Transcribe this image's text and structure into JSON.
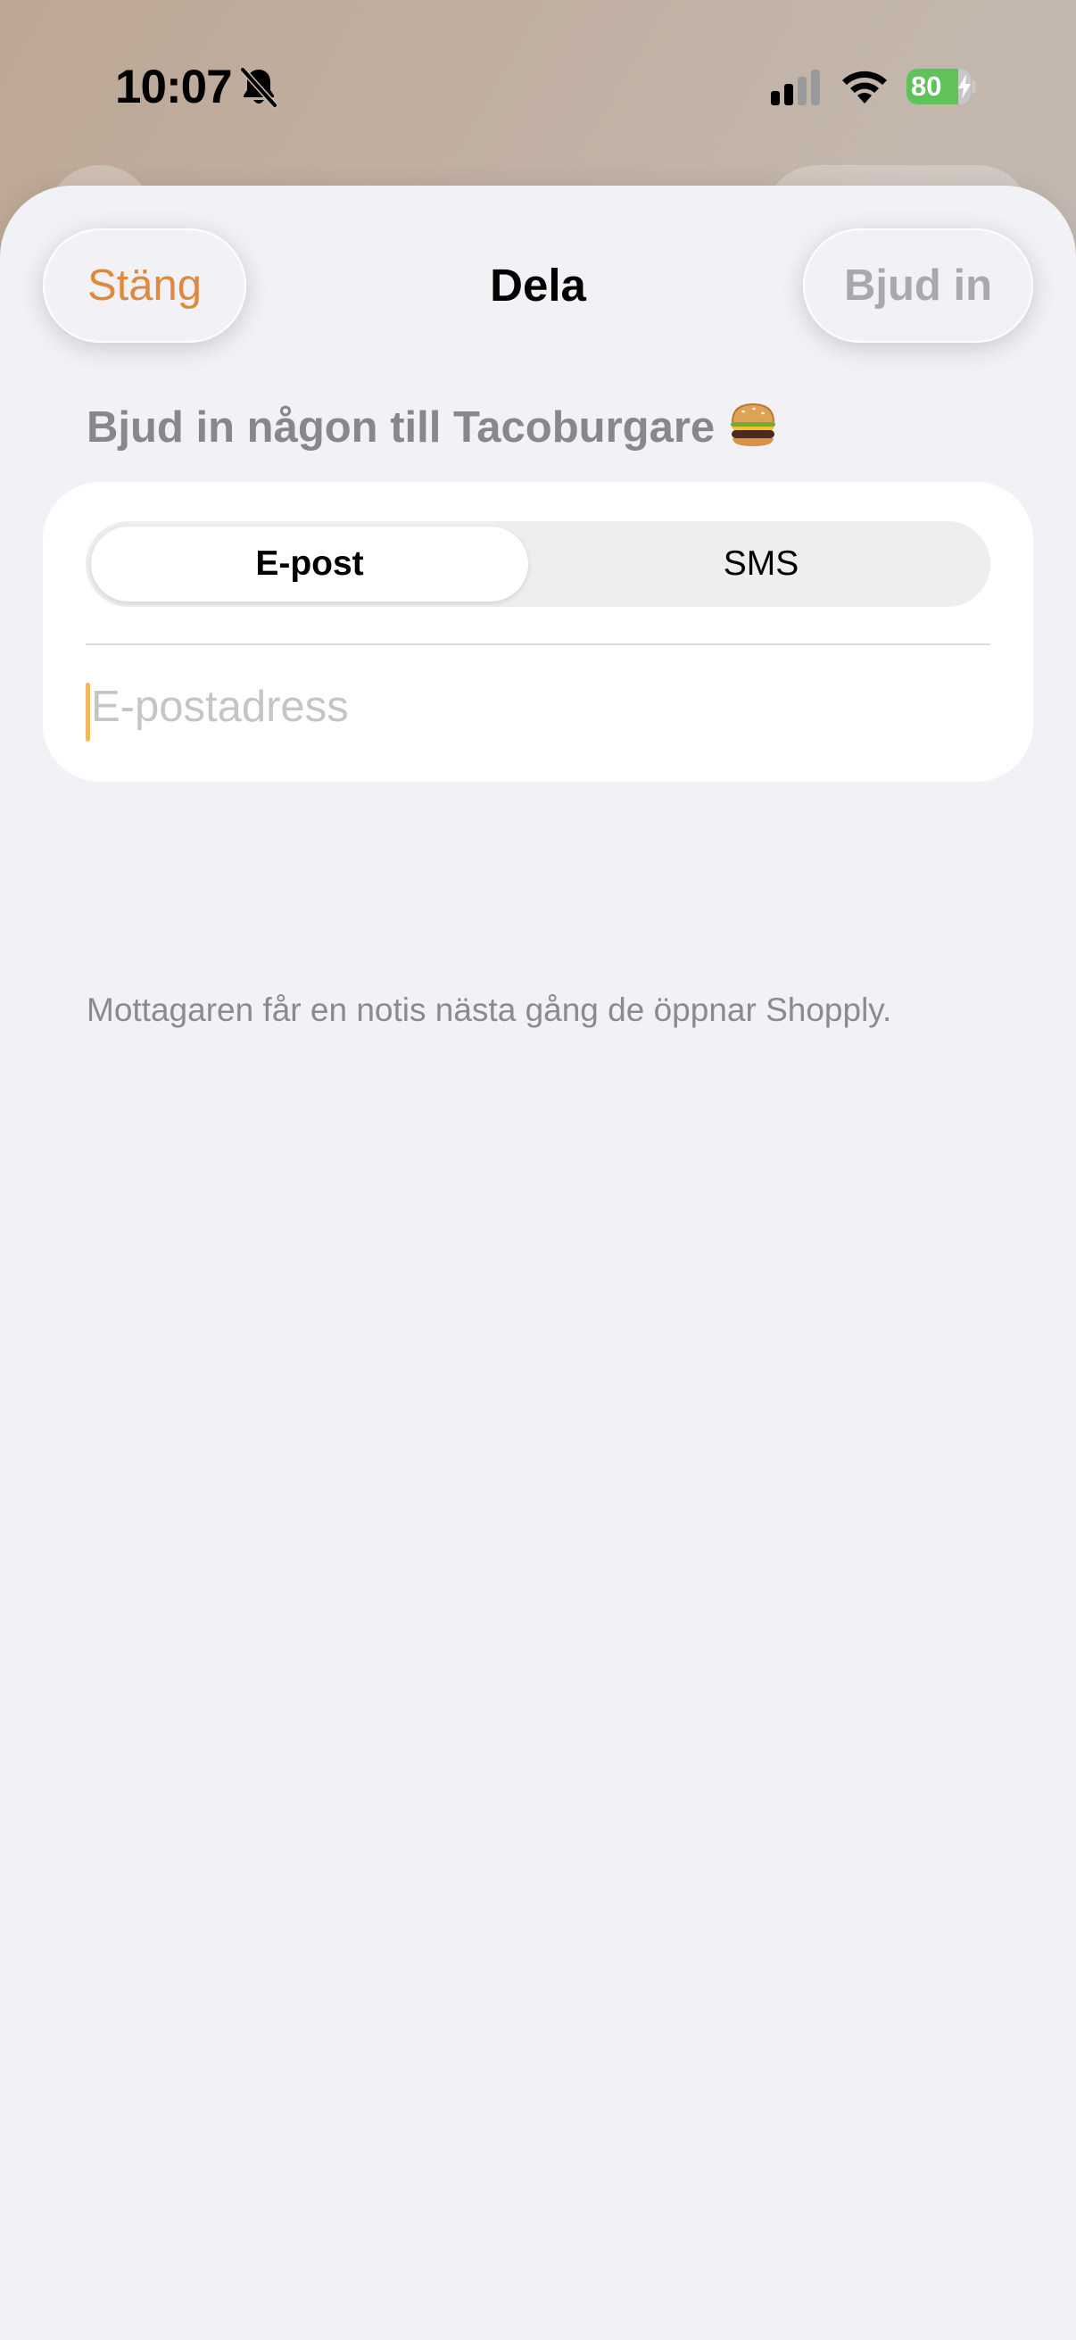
{
  "status_bar": {
    "time": "10:07",
    "battery_level": "80",
    "battery_fraction": 0.8,
    "icons": [
      "bell-slash-icon",
      "cellular-signal-icon",
      "wifi-icon",
      "battery-charging-icon"
    ]
  },
  "sheet": {
    "title": "Dela",
    "close_label": "Stäng",
    "invite_label": "Bjud in"
  },
  "invite": {
    "heading": "Bjud in någon till Tacoburgare",
    "heading_emoji": "burger-icon",
    "tabs": [
      {
        "label": "E-post",
        "selected": true
      },
      {
        "label": "SMS",
        "selected": false
      }
    ],
    "input_placeholder": "E-postadress",
    "input_value": "",
    "footnote": "Mottagaren får en notis nästa gång de öppnar Shopply."
  },
  "colors": {
    "accent": "#dd8a3f",
    "caret": "#f0b661",
    "disabled_text": "#a8a8ad",
    "secondary_text": "#87878c",
    "sheet_background": "#f1f1f6"
  }
}
